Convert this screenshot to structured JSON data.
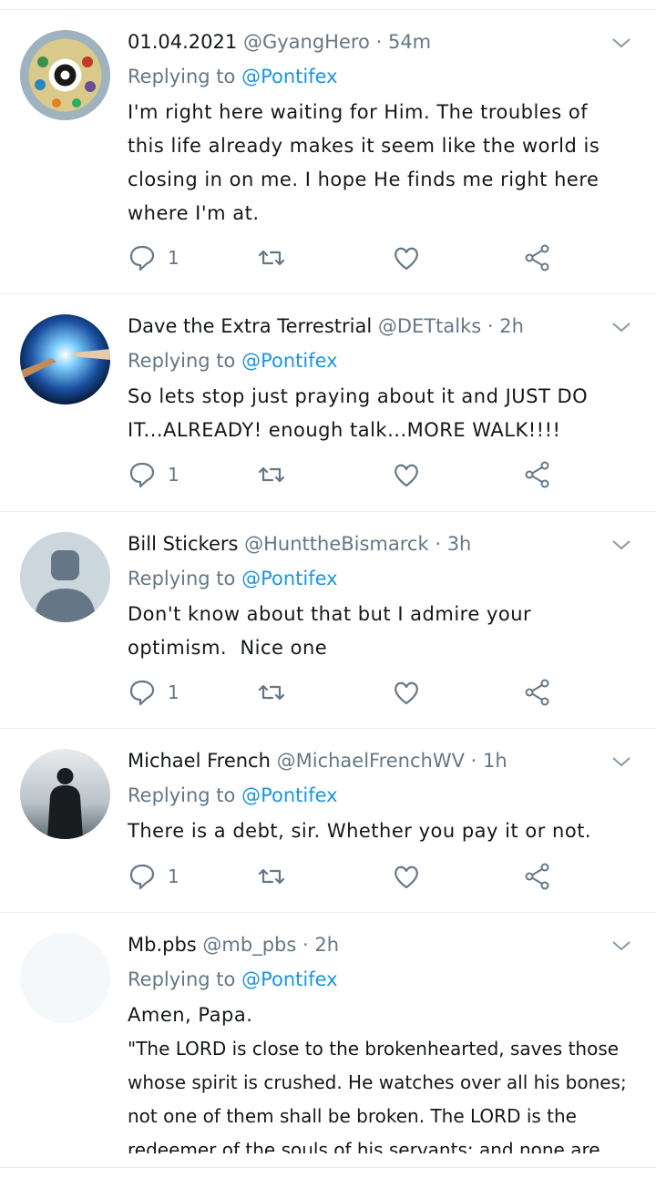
{
  "tweets": [
    {
      "name": "01.04.2021",
      "handle": "@GyangHero",
      "time": "54m",
      "replying_prefix": "Replying to",
      "replying_to": "@Pontifex",
      "body": "I'm right here waiting for Him. The troubles of this life already makes it seem like the world is closing in on me. I hope He finds me right here where I'm at.",
      "reply_count": "1"
    },
    {
      "name": "Dave the Extra Terrestrial",
      "handle": "@DETtalks",
      "time": "2h",
      "replying_prefix": "Replying to",
      "replying_to": "@Pontifex",
      "body": "So lets stop just praying about it and JUST DO IT...ALREADY! enough talk...MORE WALK!!!!",
      "reply_count": "1"
    },
    {
      "name": "Bill Stickers",
      "handle": "@HunttheBismarck",
      "time": "3h",
      "replying_prefix": "Replying to",
      "replying_to": "@Pontifex",
      "body": "Don't know about that but I admire your optimism.  Nice one",
      "reply_count": "1"
    },
    {
      "name": "Michael French",
      "handle": "@MichaelFrenchWV",
      "time": "1h",
      "replying_prefix": "Replying to",
      "replying_to": "@Pontifex",
      "body": "There is a debt, sir. Whether you pay it or not.",
      "reply_count": "1"
    },
    {
      "name": "Mb.pbs",
      "handle": "@mb_pbs",
      "time": "2h",
      "replying_prefix": "Replying to",
      "replying_to": "@Pontifex",
      "body_line1": "Amen, Papa.",
      "body_line2": "\"The LORD is close to the brokenhearted, saves those whose spirit is crushed. He watches over all his bones; not one of them shall be broken. The LORD is the redeemer of the souls of his servants; and none are conde"
    }
  ],
  "colors": {
    "link": "#1b95e0",
    "muted": "#657786",
    "text": "#14171a",
    "divider": "#e6ecf0"
  }
}
